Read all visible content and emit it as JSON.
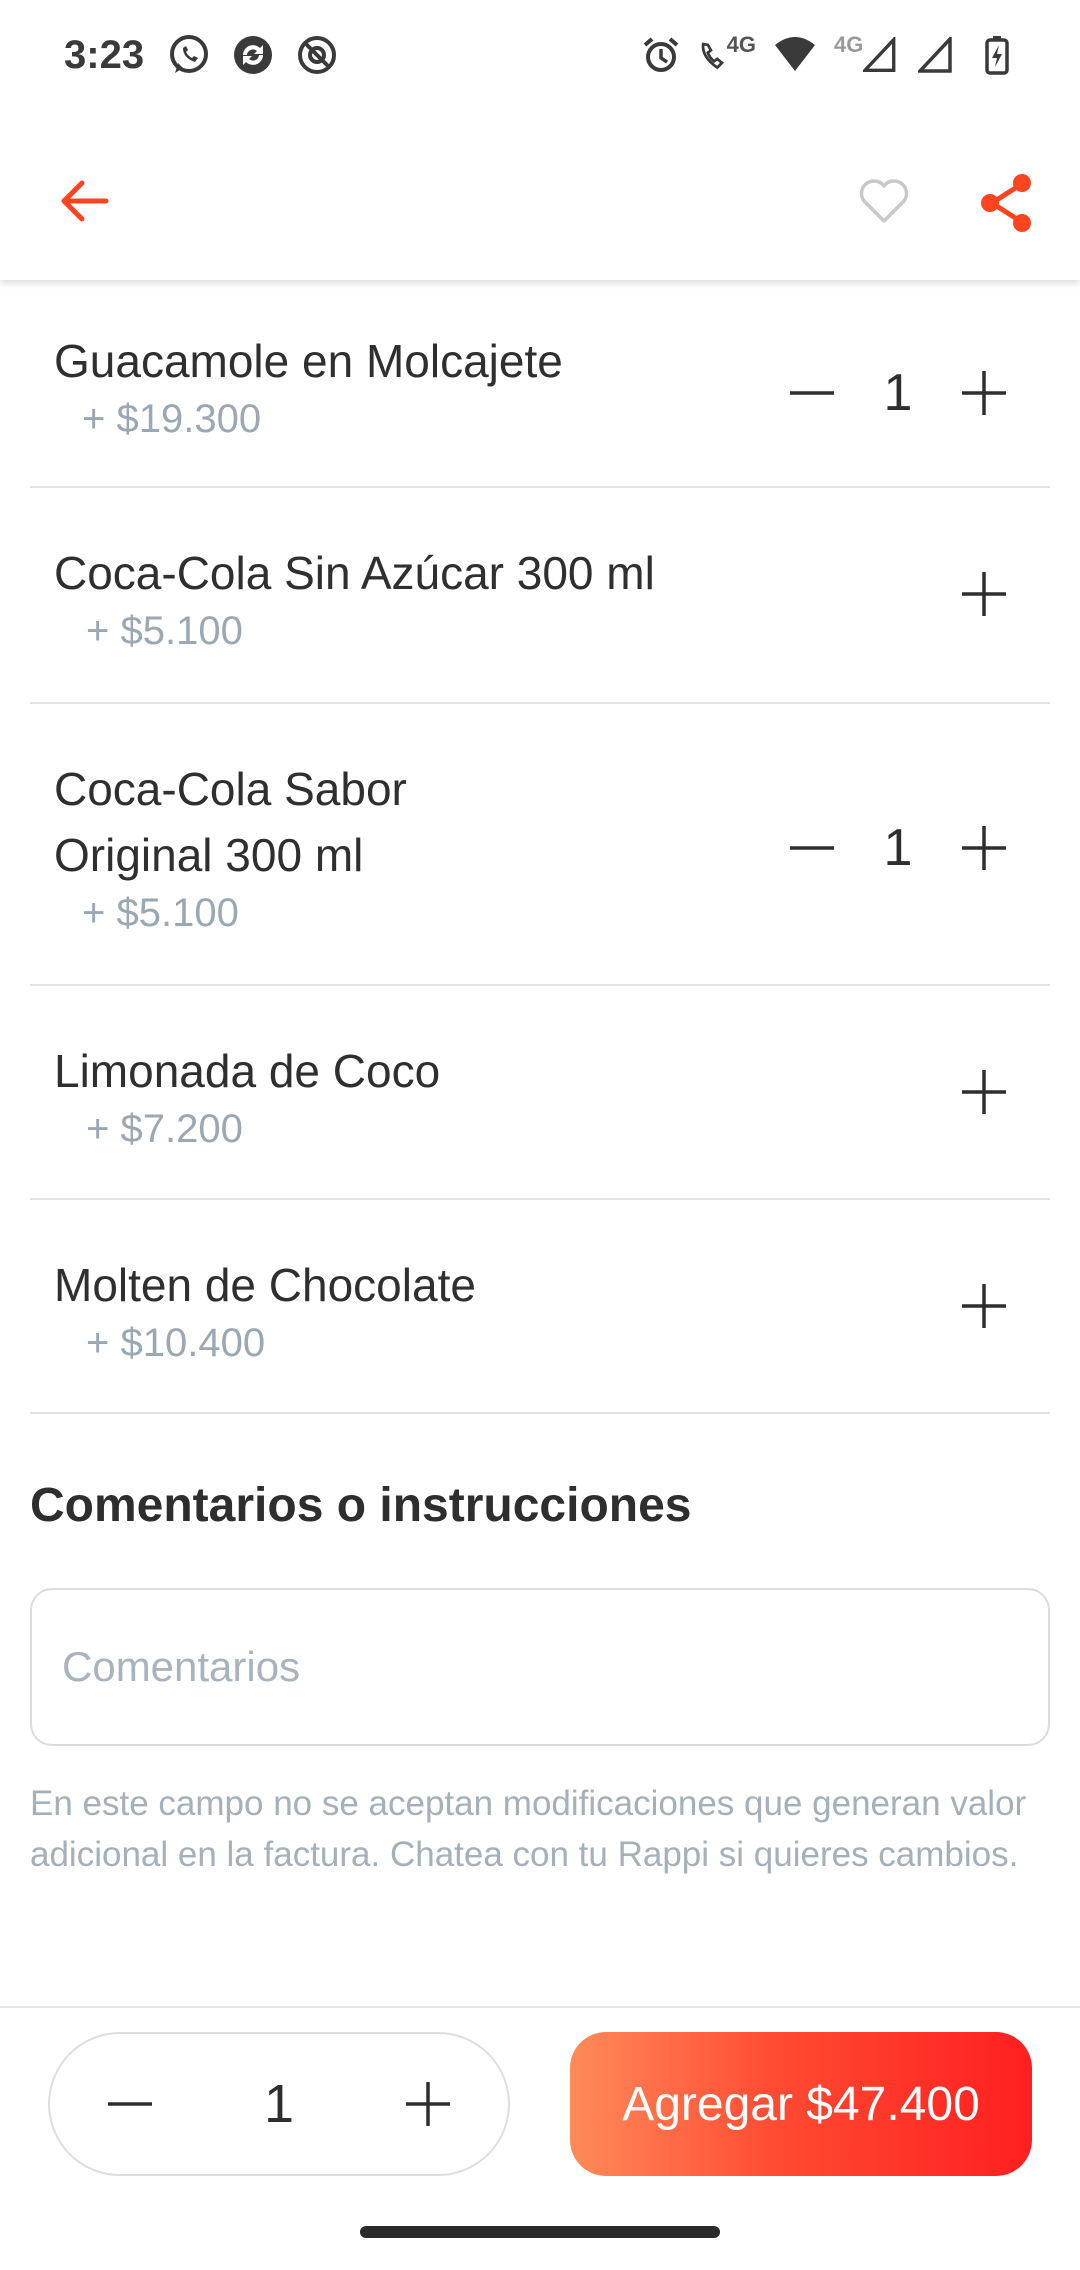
{
  "status_bar": {
    "time": "3:23",
    "left_icons": [
      "whatsapp-icon",
      "sync-icon",
      "at-sign-icon"
    ],
    "network_labels": [
      "4G",
      "4G"
    ]
  },
  "app_bar": {
    "back_icon": "back-arrow-icon",
    "favorite_icon": "heart-outline-icon",
    "share_icon": "share-icon",
    "accent_color": "#ff441f"
  },
  "items": [
    {
      "name": "Guacamole en Molcajete",
      "price": "+ $19.300",
      "quantity": "1"
    },
    {
      "name": "Coca-Cola Sin Azúcar 300 ml",
      "price": "+ $5.100",
      "quantity": null
    },
    {
      "name": "Coca-Cola Sabor Original 300 ml",
      "price": "+ $5.100",
      "quantity": "1"
    },
    {
      "name": "Limonada de Coco",
      "price": "+ $7.200",
      "quantity": null
    },
    {
      "name": "Molten de Chocolate",
      "price": "+ $10.400",
      "quantity": null
    }
  ],
  "comments": {
    "title": "Comentarios o instrucciones",
    "placeholder": "Comentarios",
    "value": "",
    "note": "En este campo no se aceptan modificaciones que generan valor adicional en la factura. Chatea con tu Rappi si quieres cambios."
  },
  "bottom_bar": {
    "quantity": "1",
    "add_button_label": "Agregar $47.400"
  }
}
